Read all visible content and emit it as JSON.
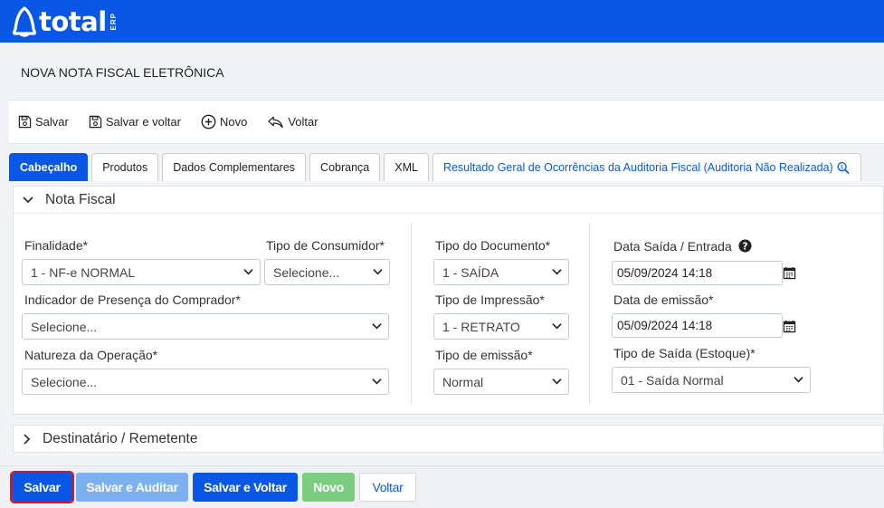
{
  "brand": {
    "name": "total",
    "suffix": "ERP",
    "bar_color": "#0a57e6"
  },
  "page": {
    "title": "NOVA NOTA FISCAL ELETRÔNICA"
  },
  "toolbar": {
    "save": "Salvar",
    "save_back": "Salvar e voltar",
    "new": "Novo",
    "back": "Voltar"
  },
  "tabs": [
    {
      "label": "Cabeçalho",
      "active": true
    },
    {
      "label": "Produtos"
    },
    {
      "label": "Dados Complementares"
    },
    {
      "label": "Cobrança"
    },
    {
      "label": "XML"
    },
    {
      "label": "Resultado Geral de Ocorrências da Auditoria Fiscal (Auditoria Não Realizada)",
      "icon": "search-money-icon"
    }
  ],
  "nota_fiscal": {
    "title": "Nota Fiscal",
    "finalidade": {
      "label": "Finalidade*",
      "value": "1 - NF-e NORMAL"
    },
    "tipo_consumidor": {
      "label": "Tipo de Consumidor*",
      "value": "Selecione..."
    },
    "indicador_presenca": {
      "label": "Indicador de Presença do Comprador*",
      "value": "Selecione..."
    },
    "natureza_operacao": {
      "label": "Natureza da Operação*",
      "value": "Selecione..."
    },
    "tipo_documento": {
      "label": "Tipo do Documento*",
      "value": "1 - SAÍDA"
    },
    "tipo_impressao": {
      "label": "Tipo de Impressão*",
      "value": "1 - RETRATO"
    },
    "tipo_emissao": {
      "label": "Tipo de emissão*",
      "value": "Normal"
    },
    "data_saida": {
      "label": "Data Saída / Entrada",
      "value": "05/09/2024 14:18"
    },
    "data_emissao": {
      "label": "Data de emissão*",
      "value": "05/09/2024 14:18"
    },
    "tipo_saida": {
      "label": "Tipo de Saída (Estoque)*",
      "value": "01 - Saída Normal"
    }
  },
  "destinatario": {
    "title": "Destinatário / Remetente"
  },
  "actions": {
    "save": "Salvar",
    "save_audit": "Salvar e Auditar",
    "save_back": "Salvar e Voltar",
    "new": "Novo",
    "back": "Voltar"
  },
  "colors": {
    "primary": "#0a57e6",
    "light_primary": "#7cb0f0",
    "success_light": "#7ccc82",
    "highlight": "#e0121f"
  }
}
